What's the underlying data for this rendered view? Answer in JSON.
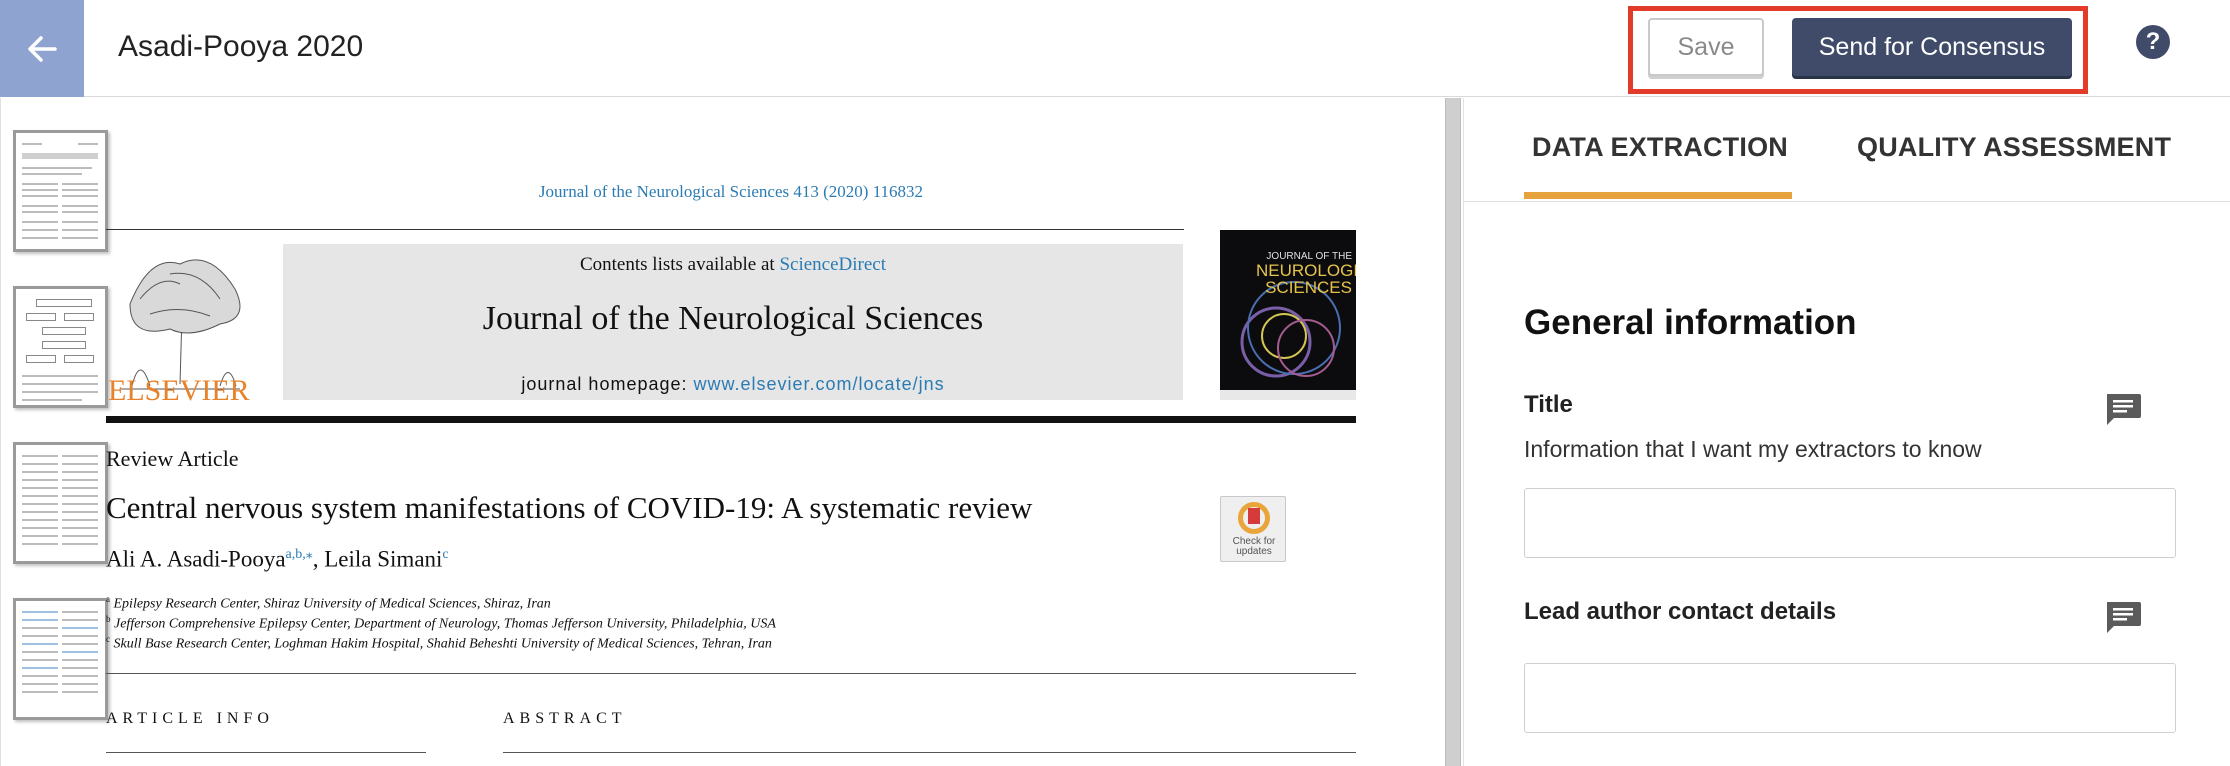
{
  "header": {
    "title": "Asadi-Pooya 2020",
    "save_label": "Save",
    "consensus_label": "Send for Consensus",
    "help_label": "?",
    "back_icon": "arrow-left-icon",
    "help_icon": "help-circle-icon"
  },
  "document": {
    "journal_ref": "Journal of the Neurological Sciences 413 (2020) 116832",
    "contents_prefix": "Contents lists available at ",
    "contents_link": "ScienceDirect",
    "journal_name": "Journal of the Neurological Sciences",
    "homepage_prefix": "journal homepage: ",
    "homepage_link": "www.elsevier.com/locate/jns",
    "publisher": "ELSEVIER",
    "cover_line1": "JOURNAL OF THE",
    "cover_line2": "NEUROLOGICAL",
    "cover_line3": "SCIENCES",
    "article_type": "Review Article",
    "article_title": "Central nervous system manifestations of COVID-19: A systematic review",
    "author1": "Ali A. Asadi-Pooya",
    "author1_sup": "a,b,⁎",
    "author_sep": ", ",
    "author2": "Leila Simani",
    "author2_sup": "c",
    "crossmark_line1": "Check for",
    "crossmark_line2": "updates",
    "affiliations": [
      {
        "mark": "a",
        "text": "Epilepsy Research Center, Shiraz University of Medical Sciences, Shiraz, Iran"
      },
      {
        "mark": "b",
        "text": "Jefferson Comprehensive Epilepsy Center, Department of Neurology, Thomas Jefferson University, Philadelphia, USA"
      },
      {
        "mark": "c",
        "text": "Skull Base Research Center, Loghman Hakim Hospital, Shahid Beheshti University of Medical Sciences, Tehran, Iran"
      }
    ],
    "article_info_head": "ARTICLE INFO",
    "abstract_head": "ABSTRACT"
  },
  "panel": {
    "tabs": [
      {
        "label": "DATA EXTRACTION",
        "active": true
      },
      {
        "label": "QUALITY ASSESSMENT",
        "active": false
      }
    ],
    "section_title": "General information",
    "fields": [
      {
        "label": "Title",
        "help": "Information that I want my extractors to know",
        "value": "",
        "placeholder": ""
      },
      {
        "label": "Lead author contact details",
        "help": "",
        "value": "",
        "placeholder": ""
      }
    ],
    "comment_icon": "comment-icon"
  },
  "colors": {
    "accent_tab": "#e6a23c",
    "primary_button": "#3f4b68",
    "highlight": "#e23b2a",
    "back_button": "#8ea3cf",
    "link": "#2b7bb3",
    "elsevier_orange": "#e8822a"
  }
}
